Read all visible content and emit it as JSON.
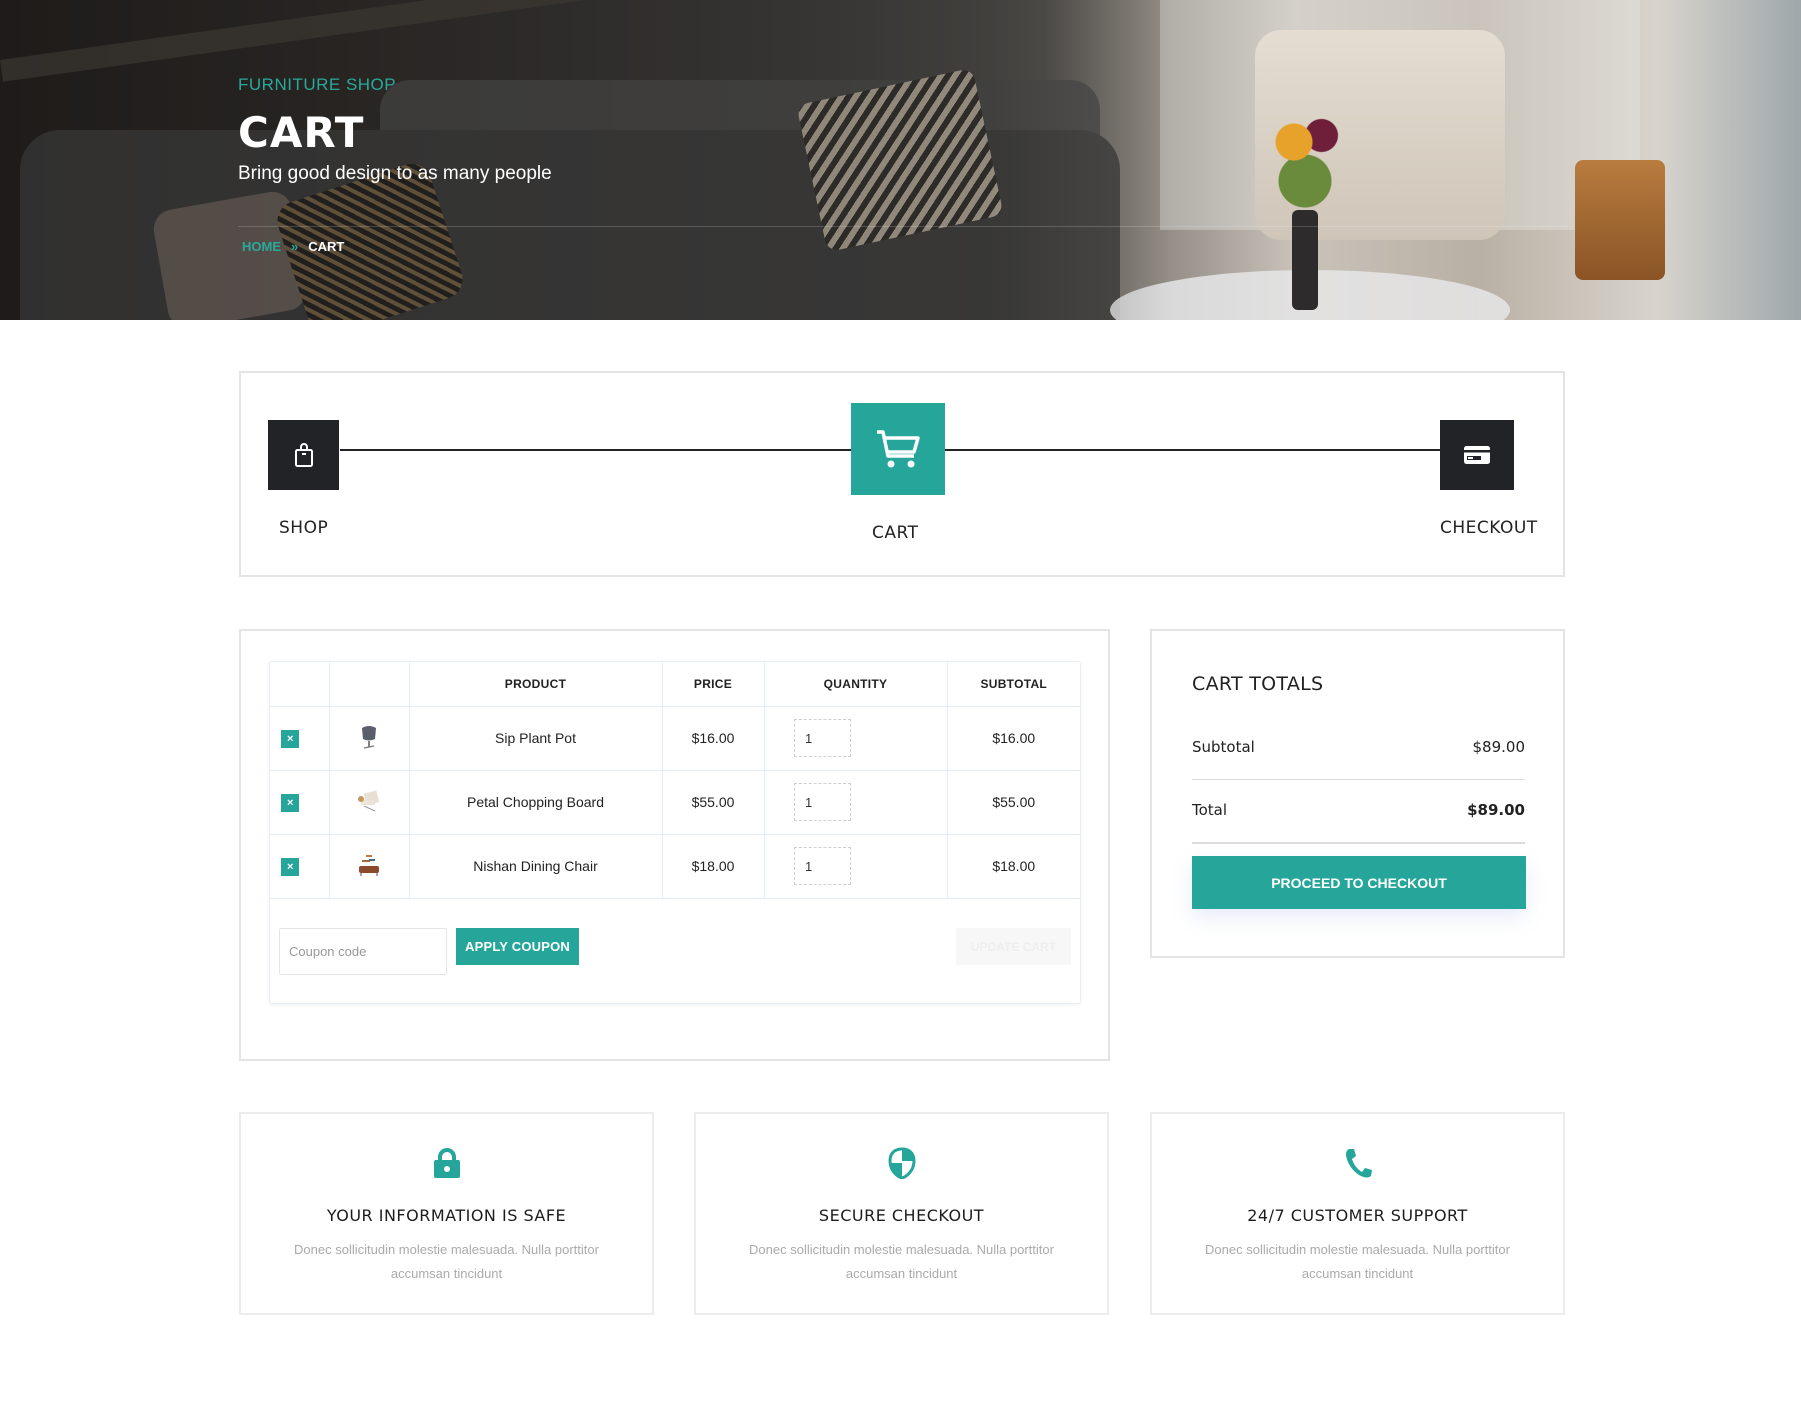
{
  "hero": {
    "kicker": "FURNITURE SHOP",
    "title": "CART",
    "subtitle": "Bring good design to as many people",
    "breadcrumb": {
      "home": "HOME",
      "separator": "»",
      "current": "CART"
    }
  },
  "steps": [
    {
      "label": "SHOP",
      "icon": "shopping-bag-icon",
      "active": false
    },
    {
      "label": "CART",
      "icon": "cart-icon",
      "active": true
    },
    {
      "label": "CHECKOUT",
      "icon": "credit-card-icon",
      "active": false
    }
  ],
  "cart_table": {
    "headers": [
      "",
      "",
      "PRODUCT",
      "PRICE",
      "QUANTITY",
      "SUBTOTAL"
    ],
    "rows": [
      {
        "remove": "×",
        "thumb": "chair-thumbnail",
        "product": "Sip Plant Pot",
        "price": "$16.00",
        "quantity": "1",
        "subtotal": "$16.00"
      },
      {
        "remove": "×",
        "thumb": "lounge-chair-thumbnail",
        "product": "Petal Chopping Board",
        "price": "$55.00",
        "quantity": "1",
        "subtotal": "$55.00"
      },
      {
        "remove": "×",
        "thumb": "sideboard-thumbnail",
        "product": "Nishan Dining Chair",
        "price": "$18.00",
        "quantity": "1",
        "subtotal": "$18.00"
      }
    ],
    "coupon_placeholder": "Coupon code",
    "apply_coupon_label": "APPLY COUPON",
    "update_cart_label": "UPDATE CART"
  },
  "cart_totals": {
    "title": "CART TOTALS",
    "subtotal_label": "Subtotal",
    "subtotal_value": "$89.00",
    "total_label": "Total",
    "total_value": "$89.00",
    "checkout_label": "PROCEED TO CHECKOUT"
  },
  "features": [
    {
      "icon": "lock-icon",
      "title": "YOUR INFORMATION IS SAFE",
      "text": "Donec sollicitudin molestie malesuada. Nulla porttitor accumsan tincidunt"
    },
    {
      "icon": "shield-icon",
      "title": "SECURE CHECKOUT",
      "text": "Donec sollicitudin molestie malesuada. Nulla porttitor accumsan tincidunt"
    },
    {
      "icon": "phone-icon",
      "title": "24/7 CUSTOMER SUPPORT",
      "text": "Donec sollicitudin molestie malesuada. Nulla porttitor accumsan tincidunt"
    }
  ],
  "colors": {
    "accent": "#26a69a",
    "dark": "#222327",
    "border": "#e4e4e4"
  }
}
